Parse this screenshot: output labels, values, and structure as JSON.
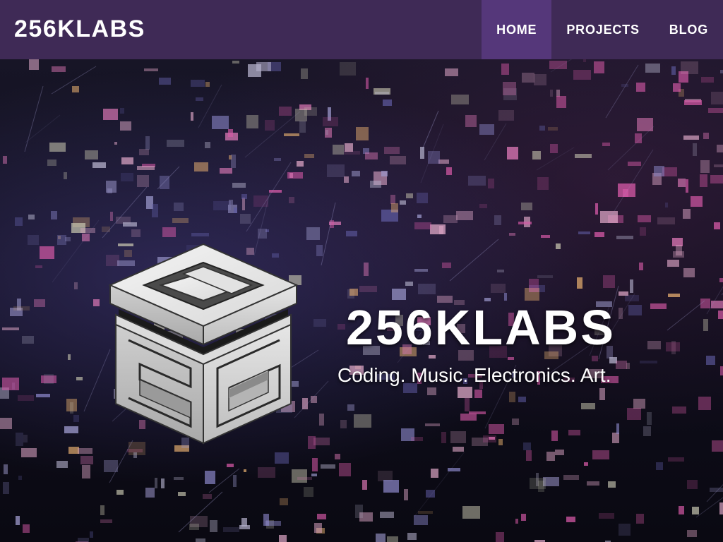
{
  "header": {
    "brand": "256KLABS",
    "nav": [
      {
        "label": "HOME",
        "active": true
      },
      {
        "label": "PROJECTS",
        "active": false
      },
      {
        "label": "BLOG",
        "active": false
      }
    ]
  },
  "hero": {
    "logo_icon": "256klabs-cube-logo",
    "title": "256KLABS",
    "tagline": "Coding. Music. Electronics. Art."
  },
  "colors": {
    "navbar": "#3f2a56",
    "nav_active": "#55377a",
    "text": "#ffffff",
    "hero_dark": "#0e0d1a",
    "pixel_palette": [
      "#c8c6b0",
      "#b7b4ce",
      "#e0a8c8",
      "#d85aa8",
      "#e8b070",
      "#8a86c8",
      "#5e5aa0",
      "#a09cd0",
      "#e07ab8"
    ]
  }
}
